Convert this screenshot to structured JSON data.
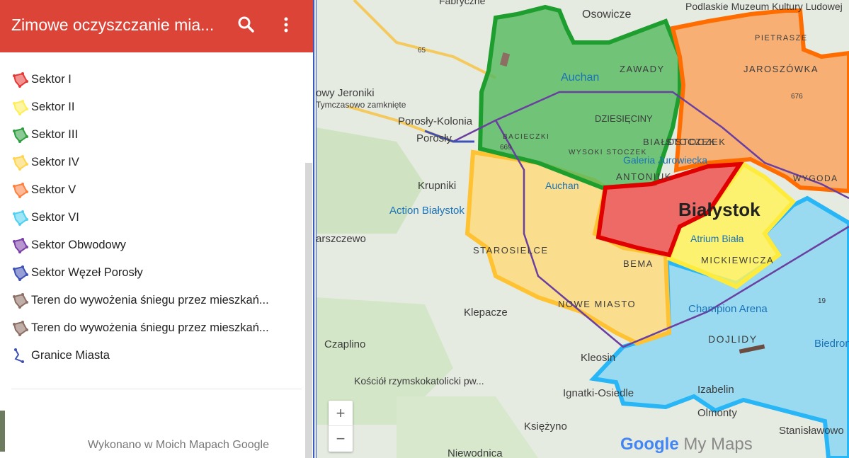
{
  "header": {
    "title": "Zimowe oczyszczanie mia...",
    "search_icon": "search-icon",
    "menu_icon": "more-vert-icon"
  },
  "legend": [
    {
      "label": "Sektor I",
      "color": "#e53935",
      "icon": "polygon-icon"
    },
    {
      "label": "Sektor II",
      "color": "#ffee58",
      "icon": "polygon-icon"
    },
    {
      "label": "Sektor III",
      "color": "#2e9e3e",
      "icon": "polygon-icon"
    },
    {
      "label": "Sektor IV",
      "color": "#ffd54f",
      "icon": "polygon-icon"
    },
    {
      "label": "Sektor V",
      "color": "#ff7f3f",
      "icon": "polygon-icon"
    },
    {
      "label": "Sektor VI",
      "color": "#4fd0f0",
      "icon": "polygon-icon"
    },
    {
      "label": "Sektor Obwodowy",
      "color": "#7b3fa8",
      "icon": "polygon-icon"
    },
    {
      "label": "Sektor Węzeł Porosły",
      "color": "#3f51b5",
      "icon": "polygon-icon"
    },
    {
      "label": "Teren do wywożenia śniegu przez mieszkań...",
      "color": "#8d6e63",
      "icon": "polygon-icon"
    },
    {
      "label": "Teren do wywożenia śniegu przez mieszkań...",
      "color": "#8d6e63",
      "icon": "polygon-icon"
    },
    {
      "label": "Granice Miasta",
      "color": "#3f51b5",
      "icon": "line-icon"
    }
  ],
  "footer": {
    "text": "Wykonano w Moich Mapach Google"
  },
  "map": {
    "places": [
      "Fabryczne",
      "Osowicze",
      "Podlaskie Muzeum Kultury Ludowej",
      "PIETRASZE",
      "JAROSZÓWKA",
      "ZAWADY",
      "Auchan",
      "DZIESIĘCINY",
      "owy Jeroniki",
      "Tymczasowo zamknięte",
      "Porosły-Kolonia",
      "Porosły",
      "BACIECZKI",
      "WYSOKI STOCZEK",
      "Galeria Jurowiecka",
      "ANTONIUK",
      "STOCZEK",
      "BIAŁOSTOCZEK",
      "WYGODA",
      "Krupniki",
      "Auchan",
      "Action Białystok",
      "Białystok",
      "Atrium Biała",
      "MICKIEWICZA",
      "DOJLIDY",
      "arszczewo",
      "STAROSIELCE",
      "BEMA",
      "NOWE MIASTO",
      "Klepacze",
      "Champion Arena",
      "Czaplino",
      "Kleosin",
      "Ignatki-Osiedle",
      "Izabelin",
      "Olmonty",
      "Kościół rzymskokatolicki pw...",
      "Księżyno",
      "Niewodnica",
      "Stanisławowo",
      "Biedronka",
      "676",
      "65",
      "669",
      "19"
    ],
    "zoom_in": "+",
    "zoom_out": "−",
    "brand_google": "Google",
    "brand_mymaps": "My Maps"
  },
  "colors": {
    "header": "#db4437",
    "city_border": "#3a5bbf"
  }
}
